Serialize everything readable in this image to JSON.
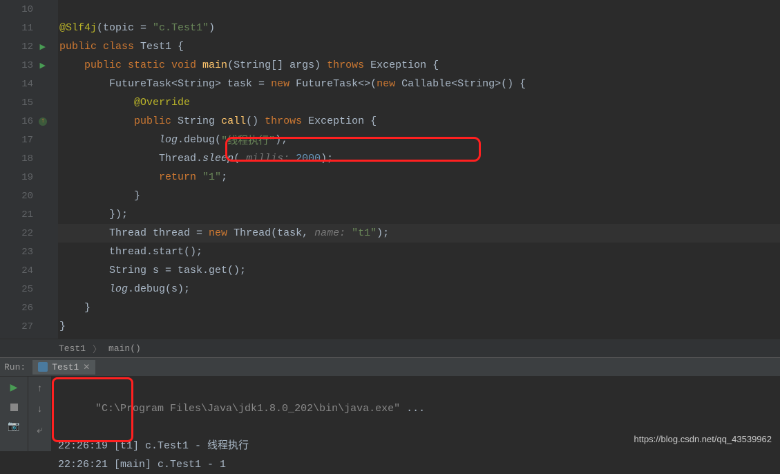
{
  "lines": [
    {
      "n": "10",
      "tokens": []
    },
    {
      "n": "11",
      "run": false,
      "tokens": [
        {
          "t": "@Slf4j",
          "c": "annotation"
        },
        {
          "t": "(topic = ",
          "c": "default"
        },
        {
          "t": "\"c.Test1\"",
          "c": "str"
        },
        {
          "t": ")",
          "c": "default"
        }
      ]
    },
    {
      "n": "12",
      "run": true,
      "tokens": [
        {
          "t": "public class ",
          "c": "kw"
        },
        {
          "t": "Test1 {",
          "c": "default"
        }
      ]
    },
    {
      "n": "13",
      "run": true,
      "tokens": [
        {
          "t": "    ",
          "c": "default"
        },
        {
          "t": "public static void ",
          "c": "kw"
        },
        {
          "t": "main",
          "c": "fn"
        },
        {
          "t": "(String[] args) ",
          "c": "default"
        },
        {
          "t": "throws ",
          "c": "kw"
        },
        {
          "t": "Exception {",
          "c": "default"
        }
      ]
    },
    {
      "n": "14",
      "tokens": [
        {
          "t": "        FutureTask<String> task = ",
          "c": "default"
        },
        {
          "t": "new ",
          "c": "kw"
        },
        {
          "t": "FutureTask<>(",
          "c": "default"
        },
        {
          "t": "new ",
          "c": "kw"
        },
        {
          "t": "Callable<String>() {",
          "c": "default"
        }
      ]
    },
    {
      "n": "15",
      "tokens": [
        {
          "t": "            ",
          "c": "default"
        },
        {
          "t": "@Override",
          "c": "annotation"
        }
      ]
    },
    {
      "n": "16",
      "override": true,
      "tokens": [
        {
          "t": "            ",
          "c": "default"
        },
        {
          "t": "public ",
          "c": "kw"
        },
        {
          "t": "String ",
          "c": "default"
        },
        {
          "t": "call",
          "c": "fn"
        },
        {
          "t": "() ",
          "c": "default"
        },
        {
          "t": "throws ",
          "c": "kw"
        },
        {
          "t": "Exception {",
          "c": "default"
        }
      ]
    },
    {
      "n": "17",
      "tokens": [
        {
          "t": "                ",
          "c": "default"
        },
        {
          "t": "log",
          "c": "italic"
        },
        {
          "t": ".debug(",
          "c": "default"
        },
        {
          "t": "\"线程执行\"",
          "c": "str"
        },
        {
          "t": ");",
          "c": "default"
        }
      ]
    },
    {
      "n": "18",
      "tokens": [
        {
          "t": "                Thread.",
          "c": "default"
        },
        {
          "t": "sleep",
          "c": "italic"
        },
        {
          "t": "( ",
          "c": "default"
        },
        {
          "t": "millis: ",
          "c": "hint"
        },
        {
          "t": "2000",
          "c": "num"
        },
        {
          "t": ");",
          "c": "default"
        }
      ]
    },
    {
      "n": "19",
      "tokens": [
        {
          "t": "                ",
          "c": "default"
        },
        {
          "t": "return ",
          "c": "kw"
        },
        {
          "t": "\"1\"",
          "c": "str"
        },
        {
          "t": ";",
          "c": "default"
        }
      ]
    },
    {
      "n": "20",
      "tokens": [
        {
          "t": "            }",
          "c": "default"
        }
      ]
    },
    {
      "n": "21",
      "tokens": [
        {
          "t": "        });",
          "c": "default"
        }
      ]
    },
    {
      "n": "22",
      "hl": true,
      "tokens": [
        {
          "t": "        Thread thread = ",
          "c": "default"
        },
        {
          "t": "new ",
          "c": "kw"
        },
        {
          "t": "Thread(task, ",
          "c": "default"
        },
        {
          "t": "name: ",
          "c": "hint"
        },
        {
          "t": "\"t1\"",
          "c": "str"
        },
        {
          "t": ");",
          "c": "default"
        }
      ]
    },
    {
      "n": "23",
      "tokens": [
        {
          "t": "        thread.start();",
          "c": "default"
        }
      ]
    },
    {
      "n": "24",
      "tokens": [
        {
          "t": "        String s = task.get();",
          "c": "default"
        }
      ]
    },
    {
      "n": "25",
      "tokens": [
        {
          "t": "        ",
          "c": "default"
        },
        {
          "t": "log",
          "c": "italic"
        },
        {
          "t": ".debug(s);",
          "c": "default"
        }
      ]
    },
    {
      "n": "26",
      "tokens": [
        {
          "t": "    }",
          "c": "default"
        }
      ]
    },
    {
      "n": "27",
      "tokens": [
        {
          "t": "}",
          "c": "default"
        }
      ]
    }
  ],
  "breadcrumb": {
    "class": "Test1",
    "method": "main()"
  },
  "run_panel": {
    "label": "Run:",
    "tab": "Test1"
  },
  "console": {
    "line1_pre": "\"C:\\Program Files\\Java\\jdk1.8.0_202\\bin\\java.exe\" ",
    "line1_post": "...",
    "line2": "22:26:19 [t1] c.Test1 - 线程执行",
    "line3": "22:26:21 [main] c.Test1 - 1"
  },
  "watermark": "https://blog.csdn.net/qq_43539962"
}
